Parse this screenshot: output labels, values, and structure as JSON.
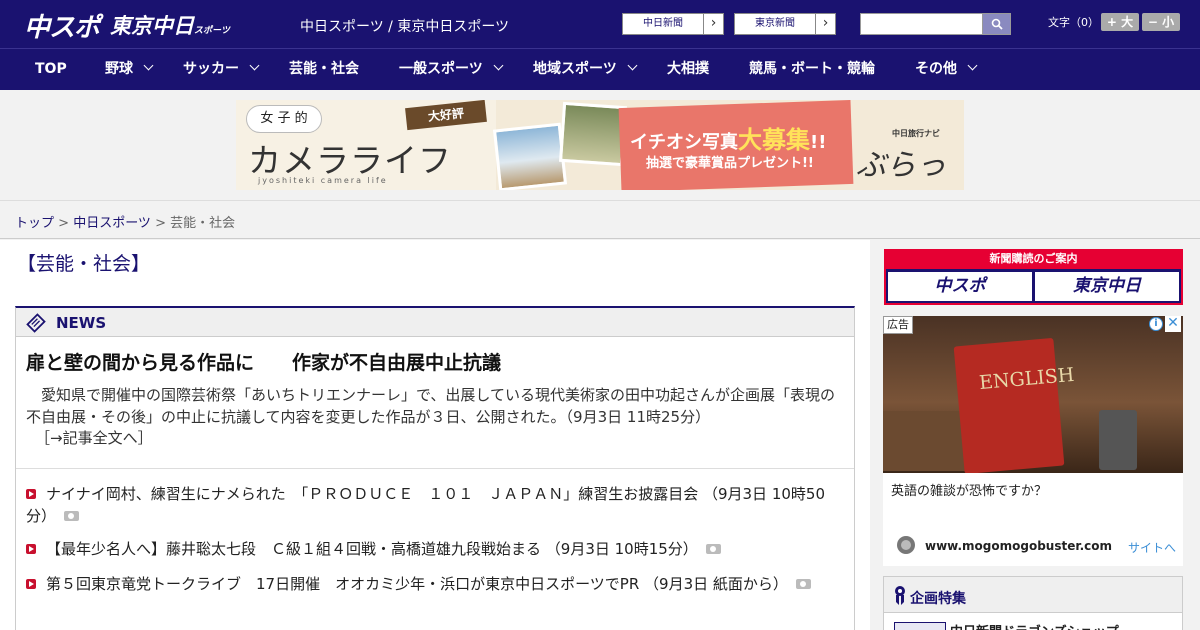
{
  "header": {
    "logo_chuspo": "中スポ",
    "logo_tokyo": "東京中日",
    "logo_tokyo_small": "スポーツ",
    "site_title": "中日スポーツ / 東京中日スポーツ",
    "btn_chunichi": "中日新聞",
    "btn_tokyo": "東京新聞",
    "search_placeholder": "",
    "font_label": "文字（0）",
    "font_up": "+ 大",
    "font_down": "− 小"
  },
  "nav": {
    "items": [
      {
        "label": "TOP",
        "has_menu": false
      },
      {
        "label": "野球",
        "has_menu": true
      },
      {
        "label": "サッカー",
        "has_menu": true
      },
      {
        "label": "芸能・社会",
        "has_menu": false
      },
      {
        "label": "一般スポーツ",
        "has_menu": true
      },
      {
        "label": "地域スポーツ",
        "has_menu": true
      },
      {
        "label": "大相撲",
        "has_menu": false
      },
      {
        "label": "競馬・ボート・競輪",
        "has_menu": false
      },
      {
        "label": "その他",
        "has_menu": true
      }
    ]
  },
  "banner": {
    "bubble": "女 子 的",
    "title": "カメラライフ",
    "sub": "jyoshiteki camera life",
    "ribbon": "大好評",
    "red_line1_pre": "イチオシ写真",
    "red_line1_big": "大募集",
    "red_line1_post": "!!",
    "red_line2": "抽選で豪華賞品プレゼント!!",
    "brand_small": "中日旅行ナビ",
    "brand": "ぶらっ人"
  },
  "breadcrumb": {
    "top": "トップ",
    "sep": " > ",
    "chunichi": "中日スポーツ",
    "current": "芸能・社会"
  },
  "main": {
    "section_title": "【芸能・社会】",
    "news_label": "NEWS",
    "lead": {
      "title": "扉と壁の間から見る作品に　　作家が不自由展中止抗議",
      "body": "　愛知県で開催中の国際芸術祭「あいちトリエンナーレ」で、出展している現代美術家の田中功起さんが企画展「表現の不自由展・その後」の中止に抗議して内容を変更した作品が３日、公開された。（9月3日 11時25分）",
      "more": "［→記事全文へ］"
    },
    "items": [
      {
        "text": "ナイナイ岡村、練習生にナメられた　「ＰＲＯＤＵＣＥ　１０１　ＪＡＰＡＮ」練習生お披露目会 （9月3日 10時50分）",
        "photo": true
      },
      {
        "text": "【最年少名人へ】藤井聡太七段　Ｃ級１組４回戦・高橋道雄九段戦始まる （9月3日 10時15分）",
        "photo": true
      },
      {
        "text": "第５回東京竜党トークライブ　17日開催　オオカミ少年・浜口が東京中日スポーツでPR （9月3日 紙面から）",
        "photo": true
      }
    ]
  },
  "sidebar": {
    "subscribe_top": "新聞購読のご案内",
    "subscribe_btn1": "中スポ",
    "subscribe_btn2": "東京中日",
    "ad_label": "広告",
    "ad_info": "i",
    "ad_close": "✕",
    "ad_book_text": "ENGLISH",
    "ad_text": "英語の雑談が恐怖ですか？",
    "ad_url": "www.mogomogobuster.com",
    "ad_link": "サイトへ",
    "feature_title": "企画特集",
    "feature_item": "中日新聞ドラゴンズショップ"
  },
  "colors": {
    "brand_navy": "#1a1270",
    "accent_red": "#e60033",
    "bullet_red": "#c8102e",
    "link_blue": "#3c8fd6"
  }
}
